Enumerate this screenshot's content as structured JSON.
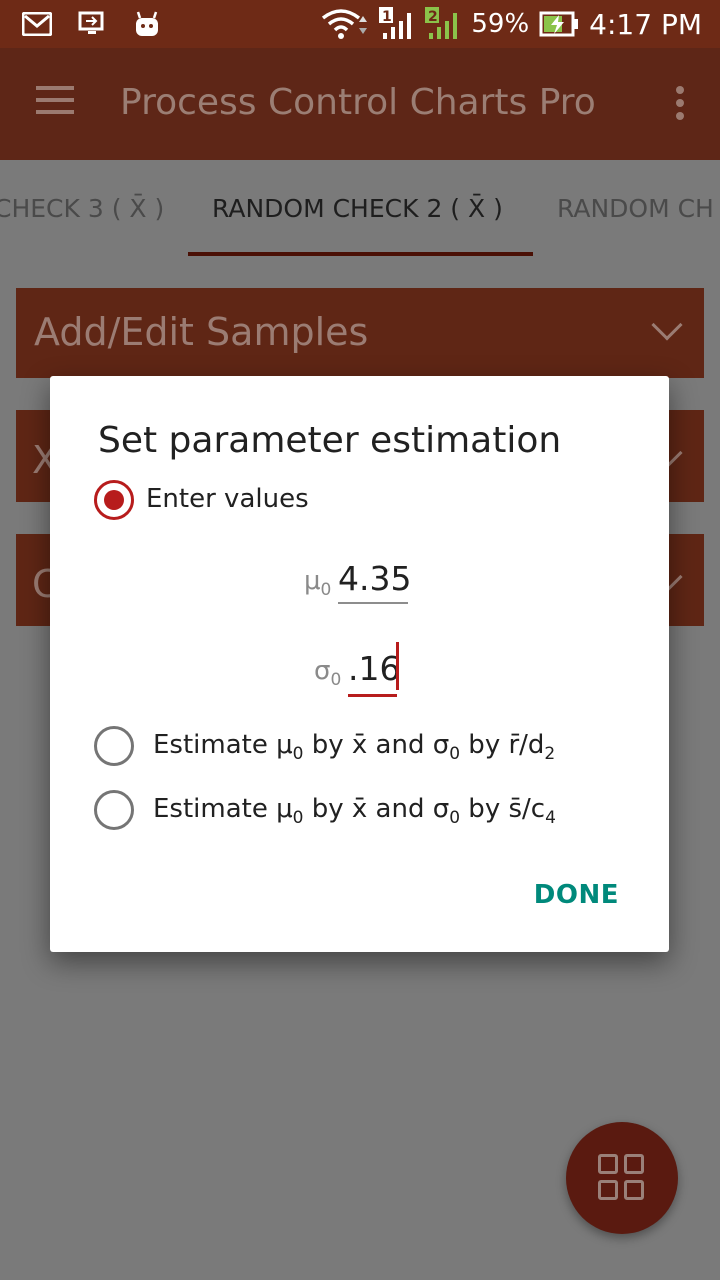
{
  "status_bar": {
    "battery": "59%",
    "time": "4:17 PM",
    "sim1": "1",
    "sim2": "2"
  },
  "app_bar": {
    "title": "Process Control Charts Pro"
  },
  "tabs": [
    {
      "label": "CHECK 3 ( X̄ )"
    },
    {
      "label": "RANDOM CHECK 2 ( X̄ )"
    },
    {
      "label": "RANDOM CH"
    }
  ],
  "panels": {
    "add_edit": "Add/Edit Samples",
    "panel2_letter": "X",
    "panel3_letter": "C"
  },
  "dialog": {
    "title": "Set parameter estimation",
    "option_enter": "Enter values",
    "mu_symbol": "μ",
    "mu_sub": "0",
    "mu_value": "4.35",
    "sigma_symbol": "σ",
    "sigma_sub": "0",
    "sigma_value": ".16",
    "option_rd": {
      "p1": "Estimate μ",
      "s1": "0",
      "p2": " by x̄̄ and σ",
      "s2": "0",
      "p3": " by r̄/d",
      "s3": "2"
    },
    "option_sc": {
      "p1": "Estimate μ",
      "s1": "0",
      "p2": " by x̄̄ and σ",
      "s2": "0",
      "p3": " by s̄/c",
      "s3": "4"
    },
    "done_label": "DONE"
  },
  "colors": {
    "accent": "#b71c1c",
    "done": "#00897b",
    "primary": "#a0401f"
  },
  "icons": [
    "gmail-icon",
    "cast-icon",
    "android-icon",
    "wifi-icon",
    "signal-icon",
    "battery-charging-icon",
    "menu-icon",
    "overflow-icon",
    "chevron-down-icon",
    "grid-icon"
  ]
}
